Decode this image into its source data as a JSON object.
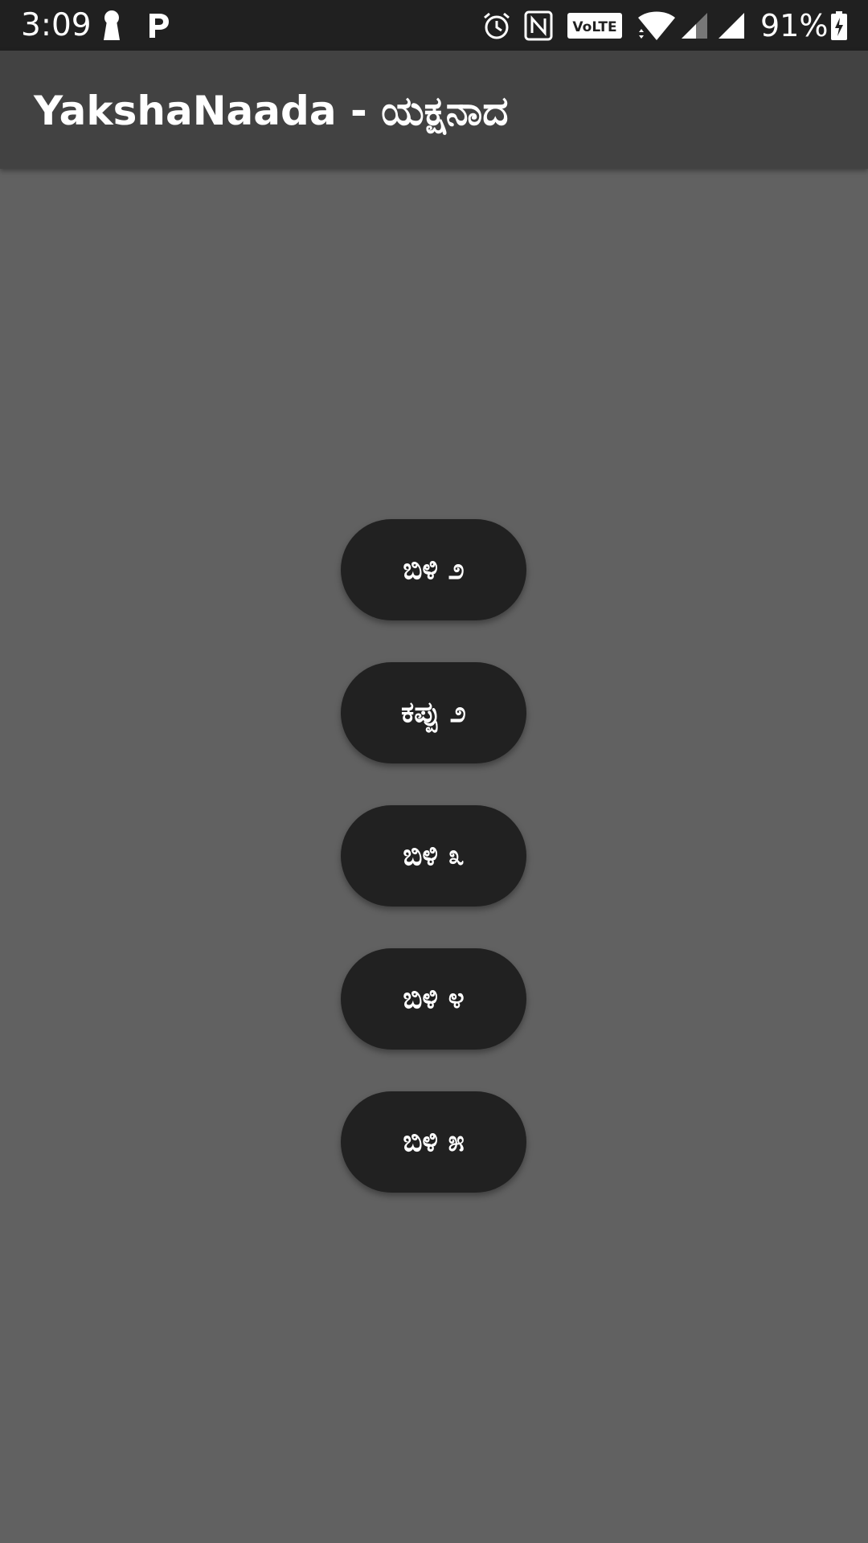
{
  "status_bar": {
    "time": "3:09",
    "battery_percent": "91%",
    "volte_label": "VoLTE",
    "icons": [
      "keyhole-icon",
      "p-app-icon",
      "alarm-icon",
      "nfc-icon",
      "volte-icon",
      "wifi-icon",
      "signal-icon",
      "signal-icon",
      "battery-charging-icon"
    ]
  },
  "app_bar": {
    "title": "YakshaNaada - ಯಕ್ಷನಾದ"
  },
  "menu": {
    "buttons": [
      {
        "label": "ಬಿಳಿ ೨"
      },
      {
        "label": "ಕಪ್ಪು ೨"
      },
      {
        "label": "ಬಿಳಿ ೩"
      },
      {
        "label": "ಬಿಳಿ ೪"
      },
      {
        "label": "ಬಿಳಿ ೫"
      }
    ]
  },
  "colors": {
    "status_bar_bg": "#202020",
    "app_bar_bg": "#424242",
    "body_bg": "#616161",
    "button_bg": "#212121",
    "text": "#ffffff"
  }
}
